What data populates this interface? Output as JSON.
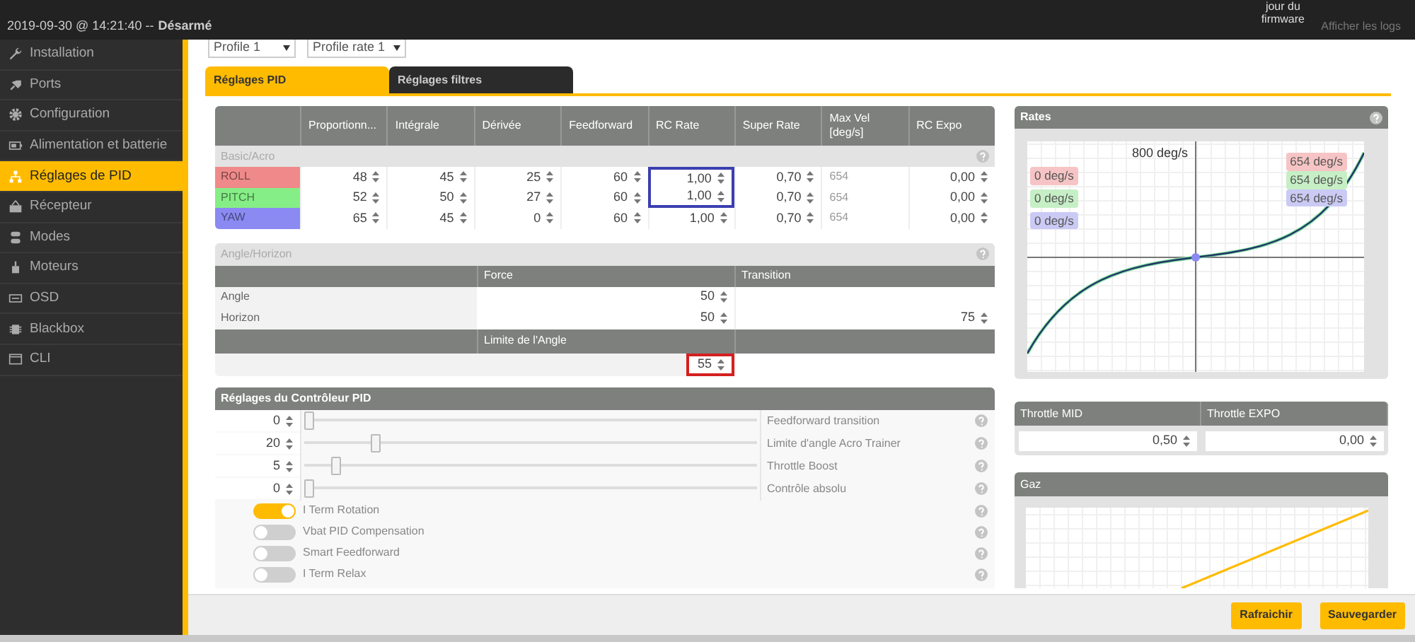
{
  "status_bar": {
    "datetime": "2019-09-30 @ 14:21:40 --",
    "arm_state": "Désarmé"
  },
  "header": {
    "firmware_button": "jour du firmware",
    "logs_link": "Afficher les logs"
  },
  "sidebar": {
    "items": [
      {
        "label": "Installation",
        "kind": "wrench",
        "selected": false
      },
      {
        "label": "Ports",
        "kind": "plug",
        "selected": false
      },
      {
        "label": "Configuration",
        "kind": "gear",
        "selected": false
      },
      {
        "label": "Alimentation et batterie",
        "kind": "battery",
        "selected": false
      },
      {
        "label": "Réglages de PID",
        "kind": "tree",
        "selected": true
      },
      {
        "label": "Récepteur",
        "kind": "receiver",
        "selected": false
      },
      {
        "label": "Modes",
        "kind": "switch",
        "selected": false
      },
      {
        "label": "Moteurs",
        "kind": "motor",
        "selected": false
      },
      {
        "label": "OSD",
        "kind": "screen",
        "selected": false
      },
      {
        "label": "Blackbox",
        "kind": "chip",
        "selected": false
      },
      {
        "label": "CLI",
        "kind": "window",
        "selected": false
      }
    ]
  },
  "profiles": [
    "Profile 1",
    "Profile rate 1"
  ],
  "tabs": [
    {
      "label": "Réglages PID",
      "selected": true
    },
    {
      "label": "Réglages filtres",
      "selected": false
    }
  ],
  "pid_table": {
    "columns": [
      {
        "label": "Proportionn...",
        "kind": "spin"
      },
      {
        "label": "Intégrale",
        "kind": "spin"
      },
      {
        "label": "Dérivée",
        "kind": "spin"
      },
      {
        "label": "Feedforward",
        "kind": "spin"
      },
      {
        "label": "RC Rate",
        "kind": "spin"
      },
      {
        "label": "Super Rate",
        "kind": "spin"
      },
      {
        "label": "Max Vel [deg/s]",
        "kind": "text"
      },
      {
        "label": "RC Expo",
        "kind": "spin"
      }
    ],
    "section": "Basic/Acro",
    "rows": [
      {
        "axis": "ROLL",
        "color": "#f08a8a",
        "values": [
          "48",
          "45",
          "25",
          "60",
          "1,00",
          "0,70",
          "654",
          "0,00"
        ],
        "rc_rate_highlighted": true
      },
      {
        "axis": "PITCH",
        "color": "#86ee86",
        "values": [
          "52",
          "50",
          "27",
          "60",
          "1,00",
          "0,70",
          "654",
          "0,00"
        ],
        "rc_rate_highlighted": true
      },
      {
        "axis": "YAW",
        "color": "#8a8af2",
        "values": [
          "65",
          "45",
          "0",
          "60",
          "1,00",
          "0,70",
          "654",
          "0,00"
        ],
        "rc_rate_highlighted": false
      }
    ]
  },
  "angle_horizon": {
    "title": "Angle/Horizon",
    "columns": [
      "Force",
      "Transition"
    ],
    "rows": [
      {
        "label": "Angle",
        "force": "50"
      },
      {
        "label": "Horizon",
        "force": "50",
        "transition": "75"
      }
    ],
    "limit": {
      "label": "Limite de l'Angle",
      "value": "55",
      "highlighted": true
    }
  },
  "pid_controller": {
    "title": "Réglages du Contrôleur PID",
    "sliders": [
      {
        "value": "0",
        "label": "Feedforward transition",
        "level": 0
      },
      {
        "value": "20",
        "label": "Limite d'angle Acro Trainer",
        "level": 0.15
      },
      {
        "value": "5",
        "label": "Throttle Boost",
        "level": 0.06
      },
      {
        "value": "0",
        "label": "Contrôle absolu",
        "level": 0
      }
    ],
    "toggles": [
      {
        "label": "I Term Rotation",
        "on": true
      },
      {
        "label": "Vbat PID Compensation",
        "on": false
      },
      {
        "label": "Smart Feedforward",
        "on": false
      },
      {
        "label": "I Term Relax",
        "on": false
      }
    ]
  },
  "rates": {
    "title": "Rates",
    "max_label": "800 deg/s",
    "min_labels": [
      {
        "text": "0 deg/s",
        "color": "#f6c4c4"
      },
      {
        "text": "0 deg/s",
        "color": "#c6efc6"
      },
      {
        "text": "0 deg/s",
        "color": "#cacaf4"
      }
    ],
    "max_labels": [
      {
        "text": "654 deg/s",
        "color": "#f6c4c4"
      },
      {
        "text": "654 deg/s",
        "color": "#c6efc6"
      },
      {
        "text": "654 deg/s",
        "color": "#cacaf4"
      }
    ]
  },
  "throttle": {
    "columns": [
      {
        "label": "Throttle MID",
        "value": "0,50"
      },
      {
        "label": "Throttle EXPO",
        "value": "0,00"
      }
    ]
  },
  "gaz": {
    "title": "Gaz"
  },
  "footer_buttons": [
    "Rafraichir",
    "Sauvegarder"
  ]
}
